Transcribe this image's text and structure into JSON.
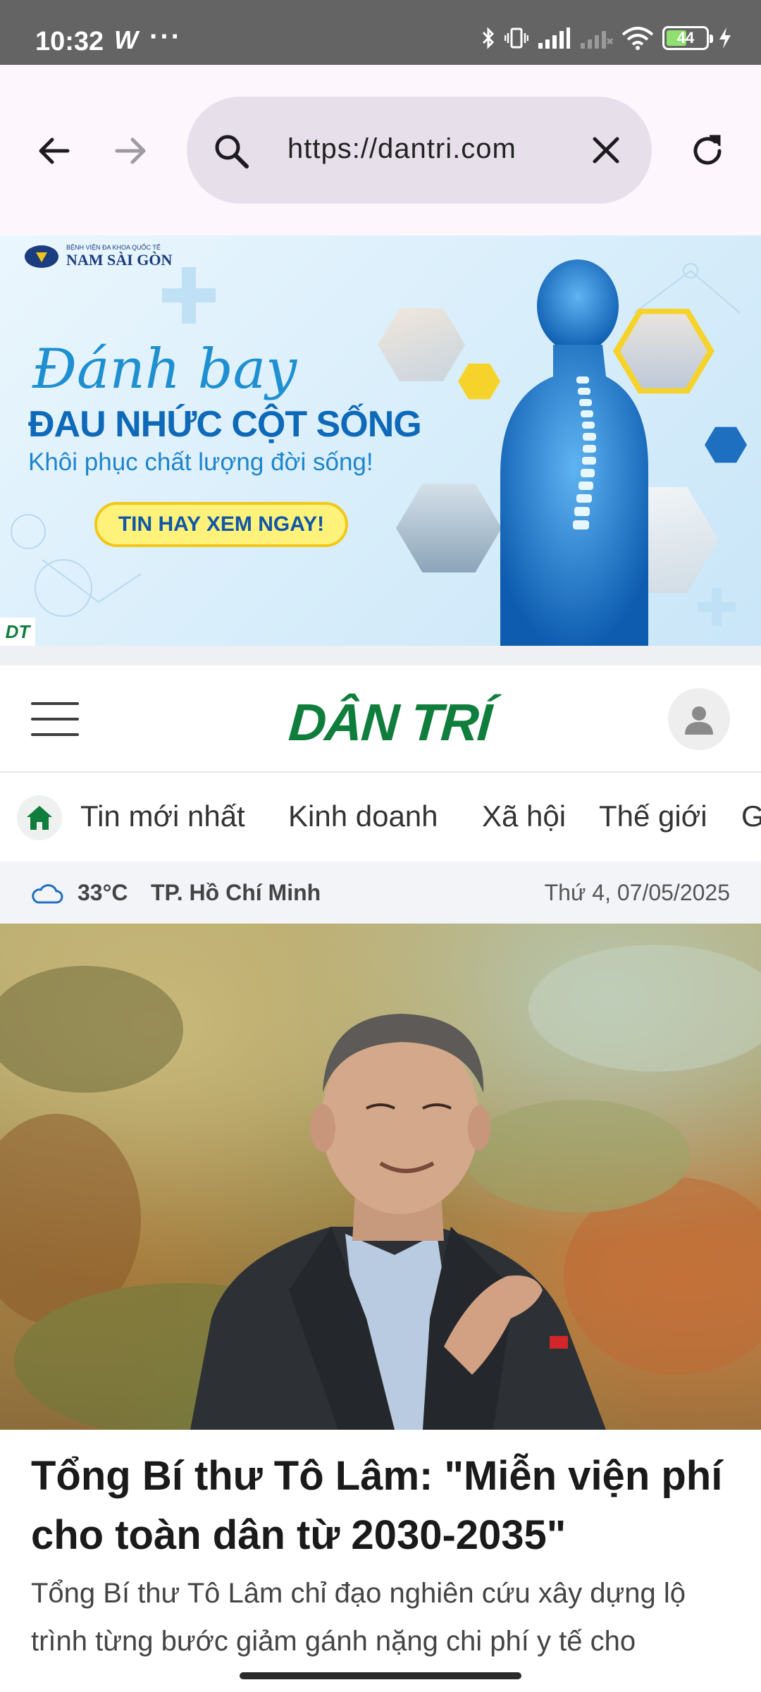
{
  "status_bar": {
    "time": "10:32",
    "app_indicator": "W",
    "more_indicator": "···",
    "battery_level": "44",
    "icons": [
      "bluetooth-icon",
      "vibrate-icon",
      "signal-icon",
      "signal-icon",
      "wifi-icon",
      "battery-icon",
      "charging-icon"
    ]
  },
  "browser": {
    "url": "https://dantri.com",
    "icons": [
      "back-arrow-icon",
      "forward-arrow-icon",
      "search-icon",
      "clear-icon",
      "reload-icon"
    ]
  },
  "ad": {
    "hospital_small": "BỆNH VIỆN ĐA KHOA QUỐC TẾ",
    "hospital_name": "NAM SÀI GÒN",
    "script_text": "Đánh bay",
    "headline": "ĐAU NHỨC CỘT SỐNG",
    "subline": "Khôi phục chất lượng đời sống!",
    "cta": "TIN HAY XEM NGAY!",
    "badge": "DT"
  },
  "site": {
    "logo": "DÂN TRÍ",
    "categories": [
      "Tin mới nhất",
      "Kinh doanh",
      "Xã hội",
      "Thế giới",
      "G"
    ]
  },
  "weather": {
    "temperature": "33°C",
    "city": "TP. Hồ Chí Minh",
    "date": "Thứ 4, 07/05/2025"
  },
  "article": {
    "title": "Tổng Bí thư Tô Lâm: \"Miễn viện phí cho toàn dân từ 2030-2035\"",
    "summary": "Tổng Bí thư Tô Lâm chỉ đạo nghiên cứu xây dựng lộ trình từng bước giảm gánh nặng chi phí y tế cho"
  },
  "colors": {
    "brand_green": "#0f7d3b",
    "status_bar": "#646464",
    "url_bar": "#e7e0eb"
  }
}
